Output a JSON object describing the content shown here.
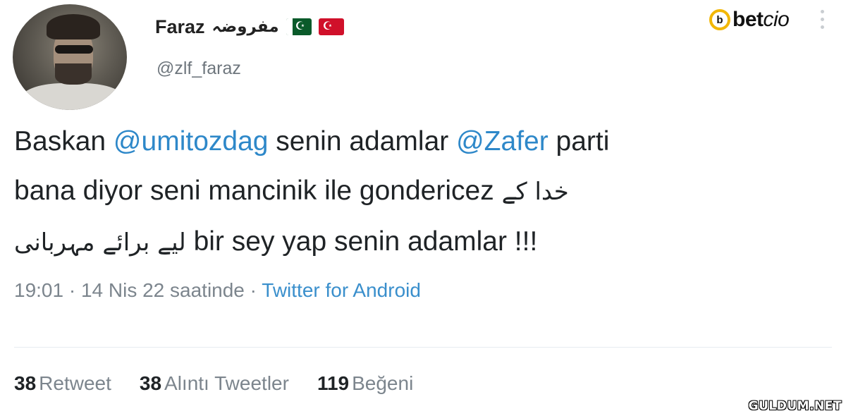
{
  "user": {
    "name": "Faraz",
    "urdu_name": "مفروضہ",
    "handle": "@zlf_faraz",
    "flags": [
      "pakistan-flag",
      "turkey-flag"
    ]
  },
  "brand": {
    "logo_b": "b",
    "logo_bet": "bet",
    "logo_cio": "cio"
  },
  "tweet": {
    "line1": {
      "t1": "Baskan ",
      "mention1": "@umitozdag",
      "t2": " senin adamlar ",
      "mention2": "@Zafer",
      "t3": " parti"
    },
    "line2": {
      "text": "bana diyor seni mancinik ile gondericez",
      "urdu": "خدا کے"
    },
    "line3": {
      "urdu": "لیے برائے مہربانی",
      "text": "bir sey yap senin adamlar !!!"
    }
  },
  "meta": {
    "timestamp": "19:01 · 14 Nis 22 saatinde",
    "separator": " · ",
    "source": "Twitter for Android"
  },
  "stats": [
    {
      "count": "38",
      "label": "Retweet"
    },
    {
      "count": "38",
      "label": "Alıntı Tweetler"
    },
    {
      "count": "119",
      "label": "Beğeni"
    }
  ],
  "watermark": "GULDUM.NET",
  "colors": {
    "mention": "#2e88c9",
    "muted": "#7c858d",
    "brand_accent": "#f2b705"
  }
}
